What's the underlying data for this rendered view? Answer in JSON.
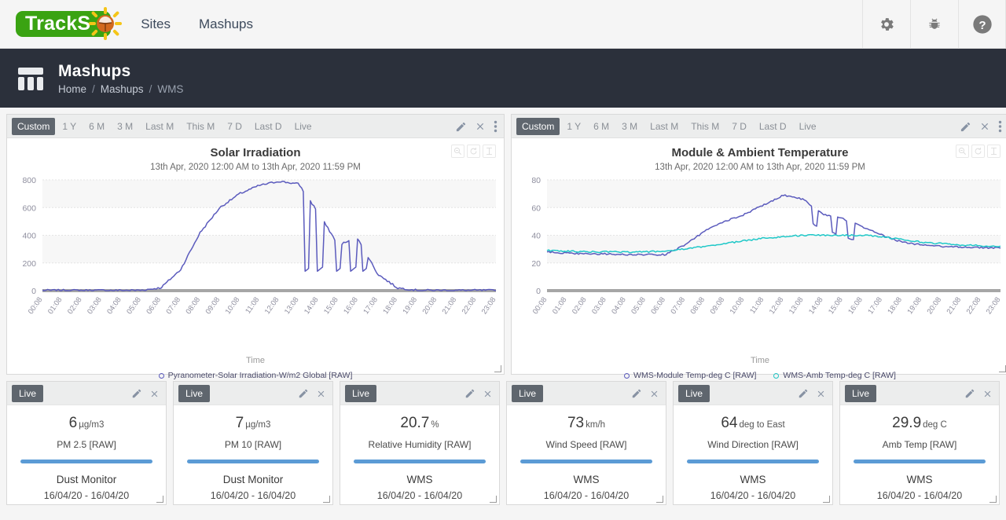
{
  "topnav": {
    "logo_text": "TrackS",
    "logo_icon": "sun-icon",
    "links": [
      {
        "label": "Sites"
      },
      {
        "label": "Mashups"
      }
    ],
    "icons": [
      {
        "name": "gear-icon"
      },
      {
        "name": "bug-icon"
      },
      {
        "name": "help-icon"
      }
    ]
  },
  "pagehead": {
    "icon": "dashboard-grid-icon",
    "title": "Mashups",
    "breadcrumb": [
      "Home",
      "Mashups",
      "WMS"
    ],
    "separator": "/"
  },
  "range_buttons": [
    "Custom",
    "1 Y",
    "6 M",
    "3 M",
    "Last M",
    "This M",
    "7 D",
    "Last D",
    "Live"
  ],
  "range_active": "Custom",
  "panel_actions": [
    {
      "name": "edit-icon"
    },
    {
      "name": "close-icon"
    },
    {
      "name": "more-menu-icon"
    }
  ],
  "chart_tools": [
    {
      "name": "zoom-out-icon"
    },
    {
      "name": "reset-icon"
    },
    {
      "name": "select-tool-icon"
    }
  ],
  "colors": {
    "series_purple": "#5b5bbd",
    "series_teal": "#1fc8c8",
    "accent_blue": "#5b9bd5",
    "badge_gray": "#5f666e",
    "header_dark": "#2b303b",
    "logo_green": "#3aa312",
    "logo_orange": "#d2691e",
    "logo_yellow": "#f5c518"
  },
  "chart_data": [
    {
      "type": "line",
      "title": "Solar Irradiation",
      "subtitle": "13th Apr, 2020 12:00 AM to 13th Apr, 2020 11:59 PM",
      "xlabel": "Time",
      "ylabel": "",
      "ylim": [
        0,
        800
      ],
      "yticks": [
        0,
        200,
        400,
        600,
        800
      ],
      "grid": true,
      "legend_position": "bottom",
      "x": [
        "00:08",
        "01:08",
        "02:08",
        "03:08",
        "04:08",
        "05:08",
        "06:08",
        "07:08",
        "08:08",
        "09:08",
        "10:08",
        "11:08",
        "12:08",
        "13:08",
        "14:08",
        "15:08",
        "16:08",
        "17:08",
        "18:08",
        "19:08",
        "20:08",
        "21:08",
        "22:08",
        "23:08"
      ],
      "series": [
        {
          "name": "Pyranometer-Solar Irradiation-W/m2 Global [RAW]",
          "color": "#5b5bbd",
          "values": [
            2,
            2,
            2,
            2,
            2,
            3,
            20,
            150,
            420,
            600,
            700,
            760,
            790,
            770,
            560,
            330,
            380,
            120,
            20,
            3,
            2,
            2,
            2,
            2
          ]
        }
      ]
    },
    {
      "type": "line",
      "title": "Module & Ambient Temperature",
      "subtitle": "13th Apr, 2020 12:00 AM to 13th Apr, 2020 11:59 PM",
      "xlabel": "Time",
      "ylabel": "",
      "ylim": [
        0,
        80
      ],
      "yticks": [
        0,
        20,
        40,
        60,
        80
      ],
      "grid": true,
      "legend_position": "bottom",
      "x": [
        "00:08",
        "01:08",
        "02:08",
        "03:08",
        "04:08",
        "05:08",
        "06:08",
        "07:08",
        "08:08",
        "09:08",
        "10:08",
        "11:08",
        "12:08",
        "13:08",
        "14:08",
        "15:08",
        "16:08",
        "17:08",
        "18:08",
        "19:08",
        "20:08",
        "21:08",
        "22:08",
        "23:08"
      ],
      "series": [
        {
          "name": "WMS-Module Temp-deg C [RAW]",
          "color": "#5b5bbd",
          "values": [
            28,
            27,
            26.5,
            26.5,
            26,
            26,
            26,
            33,
            43,
            50,
            55,
            62,
            69,
            66,
            55,
            52,
            46,
            40,
            35,
            33,
            32,
            31.5,
            31,
            31
          ]
        },
        {
          "name": "WMS-Amb Temp-deg C [RAW]",
          "color": "#1fc8c8",
          "values": [
            29,
            28.5,
            28,
            28,
            28,
            28,
            28.5,
            30,
            32,
            34,
            36,
            38,
            39,
            40,
            40,
            40,
            40,
            39,
            37,
            35,
            34,
            33,
            32.5,
            32
          ]
        }
      ]
    }
  ],
  "tiles": [
    {
      "badge": "Live",
      "value": "6",
      "unit": "µg/m3",
      "parameter": "PM 2.5 [RAW]",
      "device": "Dust Monitor",
      "dates": "16/04/20 - 16/04/20"
    },
    {
      "badge": "Live",
      "value": "7",
      "unit": "µg/m3",
      "parameter": "PM 10 [RAW]",
      "device": "Dust Monitor",
      "dates": "16/04/20 - 16/04/20"
    },
    {
      "badge": "Live",
      "value": "20.7",
      "unit": "%",
      "parameter": "Relative Humidity [RAW]",
      "device": "WMS",
      "dates": "16/04/20 - 16/04/20"
    },
    {
      "badge": "Live",
      "value": "73",
      "unit": "km/h",
      "parameter": "Wind Speed [RAW]",
      "device": "WMS",
      "dates": "16/04/20 - 16/04/20"
    },
    {
      "badge": "Live",
      "value": "64",
      "unit": "deg to East",
      "parameter": "Wind Direction [RAW]",
      "device": "WMS",
      "dates": "16/04/20 - 16/04/20"
    },
    {
      "badge": "Live",
      "value": "29.9",
      "unit": "deg C",
      "parameter": "Amb Temp [RAW]",
      "device": "WMS",
      "dates": "16/04/20 - 16/04/20"
    }
  ]
}
